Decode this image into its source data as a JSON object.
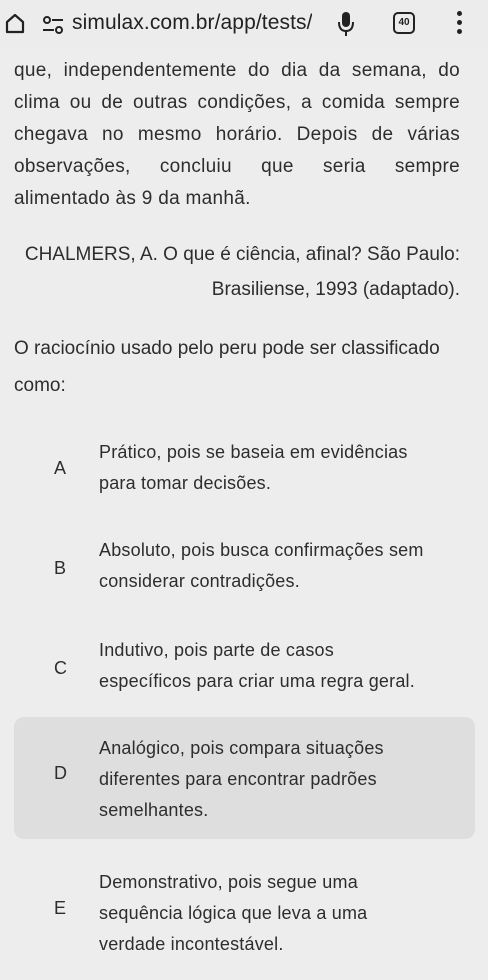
{
  "browser": {
    "url": "simulax.com.br/app/tests/",
    "tab_count": "40"
  },
  "passage": {
    "lines": [
      "que, independentemente do dia da semana, do",
      "clima ou de outras condições, a comida sempre",
      "chegava no mesmo horário. Depois de várias",
      "observações, concluiu que seria sempre",
      "alimentado às 9 da manhã."
    ]
  },
  "citation": {
    "line1": "CHALMERS, A. O que é ciência, afinal? São Paulo:",
    "line2": "Brasiliense, 1993 (adaptado)."
  },
  "question": {
    "line1": "O raciocínio usado pelo peru pode ser classificado",
    "line2": "como:"
  },
  "options": [
    {
      "letter": "A",
      "lines": [
        "Prático, pois se baseia em evidências",
        "para tomar decisões."
      ]
    },
    {
      "letter": "B",
      "lines": [
        "Absoluto, pois busca confirmações sem",
        "considerar contradições."
      ]
    },
    {
      "letter": "C",
      "lines": [
        "Indutivo, pois parte de casos",
        "específicos para criar uma regra geral."
      ]
    },
    {
      "letter": "D",
      "lines": [
        "Analógico, pois compara situações",
        "diferentes para encontrar padrões",
        "semelhantes."
      ]
    },
    {
      "letter": "E",
      "lines": [
        "Demonstrativo, pois segue uma",
        "sequência lógica que leva a uma",
        "verdade incontestável."
      ]
    }
  ],
  "colors": {
    "background": "#ededed",
    "highlight": "#dedede",
    "text": "#2d2d2d"
  }
}
